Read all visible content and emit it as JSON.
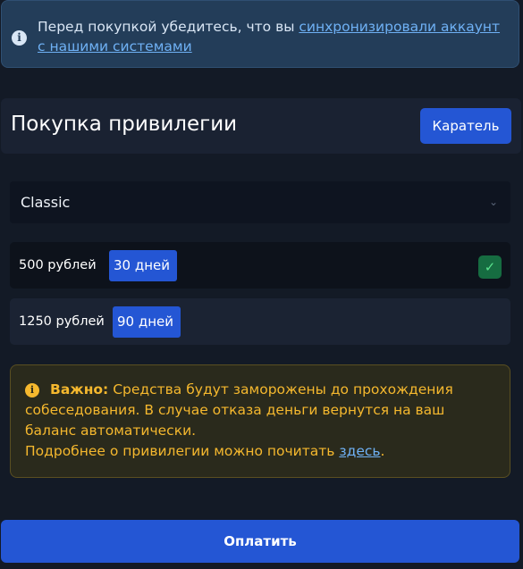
{
  "info_alert": {
    "icon": "info-icon",
    "text": "Перед покупкой убедитесь, что вы ",
    "link_text": "синхронизировали аккаунт с нашими системами"
  },
  "purchase": {
    "title": "Покупка привилегии",
    "category_button": "Каратель"
  },
  "privilege_select": {
    "selected": "Classic"
  },
  "options": [
    {
      "price": "500 рублей",
      "duration": "30 дней",
      "selected": true
    },
    {
      "price": "1250 рублей",
      "duration": "90 дней",
      "selected": false
    }
  ],
  "warning": {
    "icon": "warning-icon",
    "bold": "Важно:",
    "text": " Средства будут заморожены до прохождения собеседования. В случае отказа деньги вернутся на ваш баланс автоматически.",
    "more_prefix": "Подробнее о привилегии можно почитать ",
    "link_text": "здесь",
    "more_suffix": "."
  },
  "pay_button": "Оплатить",
  "colors": {
    "background": "#131a26",
    "accent": "#2456d4",
    "info_bg": "#233d59",
    "warning_text": "#f5b82e",
    "success": "#166c41"
  }
}
